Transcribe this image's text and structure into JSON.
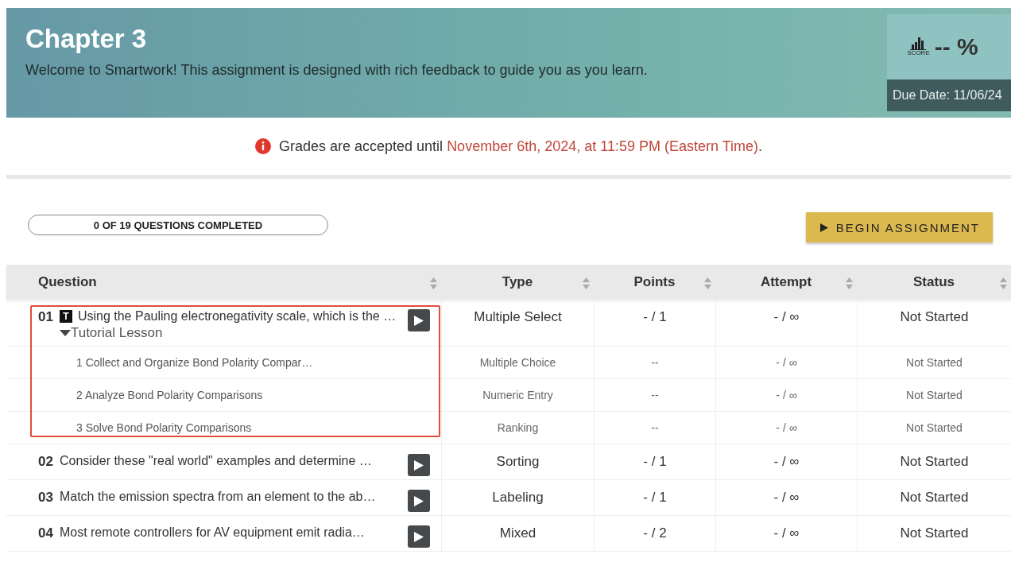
{
  "header": {
    "title": "Chapter 3",
    "subtitle": "Welcome to Smartwork! This assignment is designed with rich feedback to guide you as you learn.",
    "score": {
      "label": "SCORE",
      "value": "-- %"
    },
    "due_date": "Due Date: 11/06/24"
  },
  "notice": {
    "prefix": "Grades are accepted until ",
    "link": "November 6th, 2024, at 11:59 PM (Eastern Time)",
    "suffix": "."
  },
  "progress": {
    "label": "0 OF 19 QUESTIONS COMPLETED",
    "level": 0
  },
  "begin_button": {
    "label": "BEGIN ASSIGNMENT"
  },
  "table": {
    "columns": [
      {
        "label": "Question"
      },
      {
        "label": "Type"
      },
      {
        "label": "Points"
      },
      {
        "label": "Attempt"
      },
      {
        "label": "Status"
      }
    ],
    "rows": [
      {
        "number": "01",
        "tutorial": true,
        "badge": "T",
        "title": "Using the Pauling electronegativity scale, which is the …",
        "type": "Multiple Select",
        "points": "- / 1",
        "attempt": "- / ∞",
        "status": "Not Started",
        "lesson": {
          "label": "Tutorial Lesson",
          "expanded": true,
          "steps": [
            {
              "title": "1 Collect and Organize Bond Polarity Compar…",
              "type": "Multiple Choice",
              "points": "--",
              "attempt": "- / ∞",
              "status": "Not Started"
            },
            {
              "title": "2 Analyze Bond Polarity Comparisons",
              "type": "Numeric Entry",
              "points": "--",
              "attempt": "- / ∞",
              "status": "Not Started"
            },
            {
              "title": "3 Solve Bond Polarity Comparisons",
              "type": "Ranking",
              "points": "--",
              "attempt": "- / ∞",
              "status": "Not Started"
            }
          ]
        }
      },
      {
        "number": "02",
        "tutorial": false,
        "title": "Consider these \"real world\" examples and determine …",
        "type": "Sorting",
        "points": "- / 1",
        "attempt": "- / ∞",
        "status": "Not Started"
      },
      {
        "number": "03",
        "tutorial": false,
        "title": "Match the emission spectra from an element to the ab…",
        "type": "Labeling",
        "points": "- / 1",
        "attempt": "- / ∞",
        "status": "Not Started"
      },
      {
        "number": "04",
        "tutorial": false,
        "title": "Most remote controllers for AV equipment emit radia…",
        "type": "Mixed",
        "points": "- / 2",
        "attempt": "- / ∞",
        "status": "Not Started"
      }
    ]
  }
}
